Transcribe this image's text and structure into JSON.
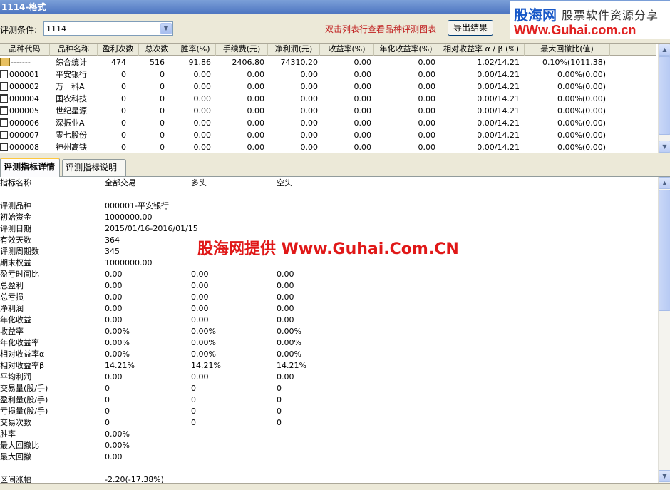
{
  "window": {
    "title": "1114-格式"
  },
  "brand": {
    "logo": "股海网",
    "slogan": "股票软件资源分享",
    "url": "WWw.Guhai.com.cn"
  },
  "criteria": {
    "label": "评测条件:",
    "value": "1114",
    "hint": "双击列表行查看品种评测图表",
    "export_label": "导出结果"
  },
  "grid": {
    "columns": [
      "品种代码",
      "品种名称",
      "盈利次数",
      "总次数",
      "胜率(%)",
      "手续费(元)",
      "净利润(元)",
      "收益率(%)",
      "年化收益率(%)",
      "相对收益率 α / β (%)",
      "最大回撤比(值)"
    ],
    "rows": [
      {
        "code": "-------",
        "name": "综合统计",
        "win": "474",
        "total": "516",
        "rate": "91.86",
        "fee": "2406.80",
        "profit": "74310.20",
        "ret": "0.00",
        "annual": "0.00",
        "rel": "1.02/14.21",
        "dd": "0.10%(1011.38)",
        "summary": true
      },
      {
        "code": "000001",
        "name": "平安银行",
        "win": "0",
        "total": "0",
        "rate": "0.00",
        "fee": "0.00",
        "profit": "0.00",
        "ret": "0.00",
        "annual": "0.00",
        "rel": "0.00/14.21",
        "dd": "0.00%(0.00)"
      },
      {
        "code": "000002",
        "name": "万　科A",
        "win": "0",
        "total": "0",
        "rate": "0.00",
        "fee": "0.00",
        "profit": "0.00",
        "ret": "0.00",
        "annual": "0.00",
        "rel": "0.00/14.21",
        "dd": "0.00%(0.00)"
      },
      {
        "code": "000004",
        "name": "国农科技",
        "win": "0",
        "total": "0",
        "rate": "0.00",
        "fee": "0.00",
        "profit": "0.00",
        "ret": "0.00",
        "annual": "0.00",
        "rel": "0.00/14.21",
        "dd": "0.00%(0.00)"
      },
      {
        "code": "000005",
        "name": "世纪星源",
        "win": "0",
        "total": "0",
        "rate": "0.00",
        "fee": "0.00",
        "profit": "0.00",
        "ret": "0.00",
        "annual": "0.00",
        "rel": "0.00/14.21",
        "dd": "0.00%(0.00)"
      },
      {
        "code": "000006",
        "name": "深振业A",
        "win": "0",
        "total": "0",
        "rate": "0.00",
        "fee": "0.00",
        "profit": "0.00",
        "ret": "0.00",
        "annual": "0.00",
        "rel": "0.00/14.21",
        "dd": "0.00%(0.00)"
      },
      {
        "code": "000007",
        "name": "零七股份",
        "win": "0",
        "total": "0",
        "rate": "0.00",
        "fee": "0.00",
        "profit": "0.00",
        "ret": "0.00",
        "annual": "0.00",
        "rel": "0.00/14.21",
        "dd": "0.00%(0.00)"
      },
      {
        "code": "000008",
        "name": "神州高铁",
        "win": "0",
        "total": "0",
        "rate": "0.00",
        "fee": "0.00",
        "profit": "0.00",
        "ret": "0.00",
        "annual": "0.00",
        "rel": "0.00/14.21",
        "dd": "0.00%(0.00)"
      }
    ]
  },
  "tabs": [
    {
      "label": "评测指标详情",
      "active": true
    },
    {
      "label": "评测指标说明",
      "active": false
    }
  ],
  "detail": {
    "headers": [
      "指标名称",
      "全部交易",
      "多头",
      "空头"
    ],
    "rows": [
      [
        "评测品种",
        "000001-平安银行",
        "",
        ""
      ],
      [
        "初始资金",
        "1000000.00",
        "",
        ""
      ],
      [
        "评测日期",
        "2015/01/16-2016/01/15",
        "",
        ""
      ],
      [
        "有效天数",
        "364",
        "",
        ""
      ],
      [
        "评测周期数",
        "345",
        "",
        ""
      ],
      [
        "期末权益",
        "1000000.00",
        "",
        ""
      ],
      [
        "盈亏时间比",
        "0.00",
        "0.00",
        "0.00"
      ],
      [
        "总盈利",
        "0.00",
        "0.00",
        "0.00"
      ],
      [
        "总亏损",
        "0.00",
        "0.00",
        "0.00"
      ],
      [
        "净利润",
        "0.00",
        "0.00",
        "0.00"
      ],
      [
        "年化收益",
        "0.00",
        "0.00",
        "0.00"
      ],
      [
        "收益率",
        "0.00%",
        "0.00%",
        "0.00%"
      ],
      [
        "年化收益率",
        "0.00%",
        "0.00%",
        "0.00%"
      ],
      [
        "相对收益率α",
        "0.00%",
        "0.00%",
        "0.00%"
      ],
      [
        "相对收益率β",
        "14.21%",
        "14.21%",
        "14.21%"
      ],
      [
        "平均利润",
        "0.00",
        "0.00",
        "0.00"
      ],
      [
        "交易量(股/手)",
        "0",
        "0",
        "0"
      ],
      [
        "盈利量(股/手)",
        "0",
        "0",
        "0"
      ],
      [
        "亏损量(股/手)",
        "0",
        "0",
        "0"
      ],
      [
        "交易次数",
        "0",
        "0",
        "0"
      ],
      [
        "胜率",
        "0.00%",
        "",
        ""
      ],
      [
        "最大回撤比",
        "0.00%",
        "",
        ""
      ],
      [
        "最大回撤",
        "0.00",
        "",
        ""
      ],
      [
        "",
        "",
        "",
        ""
      ],
      [
        "区间涨幅",
        "-2.20(-17.38%)",
        "",
        ""
      ]
    ],
    "watermark": "股海网提供 Www.Guhai.Com.CN"
  }
}
